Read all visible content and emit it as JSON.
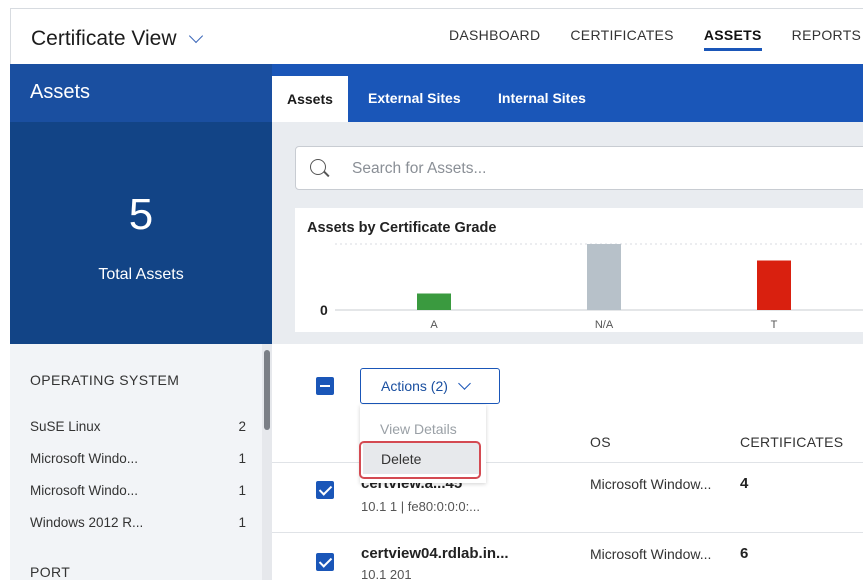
{
  "header": {
    "app_title": "Certificate View",
    "nav": [
      "DASHBOARD",
      "CERTIFICATES",
      "ASSETS",
      "REPORTS"
    ]
  },
  "sidebar": {
    "title": "Assets",
    "total_count": "5",
    "total_label": "Total Assets",
    "os_section": "OPERATING SYSTEM",
    "os_filters": [
      {
        "label": "SuSE Linux",
        "count": "2"
      },
      {
        "label": "Microsoft Windo...",
        "count": "1"
      },
      {
        "label": "Microsoft Windo...",
        "count": "1"
      },
      {
        "label": "Windows 2012 R...",
        "count": "1"
      }
    ],
    "port_section": "PORT"
  },
  "tabs": [
    "Assets",
    "External Sites",
    "Internal Sites"
  ],
  "search": {
    "placeholder": "Search for Assets..."
  },
  "chart_data": {
    "type": "bar",
    "title": "Assets by Certificate Grade",
    "y_tick": "0",
    "categories": [
      "A",
      "N/A",
      "T"
    ],
    "values": [
      1,
      4,
      3
    ],
    "colors": [
      "#3a9a3f",
      "#b7c1c9",
      "#d9200f"
    ]
  },
  "list": {
    "actions_label": "Actions (2)",
    "menu": [
      "View Details",
      "Delete"
    ],
    "columns": {
      "os": "OS",
      "certificates": "CERTIFICATES"
    },
    "rows": [
      {
        "name": "certview.a...45",
        "sub": "10.1        1 | fe80:0:0:0:...",
        "os": "Microsoft Window...",
        "certs": "4"
      },
      {
        "name": "certview04.rdlab.in...",
        "sub": "10.1          201",
        "os": "Microsoft Window...",
        "certs": "6"
      }
    ]
  }
}
